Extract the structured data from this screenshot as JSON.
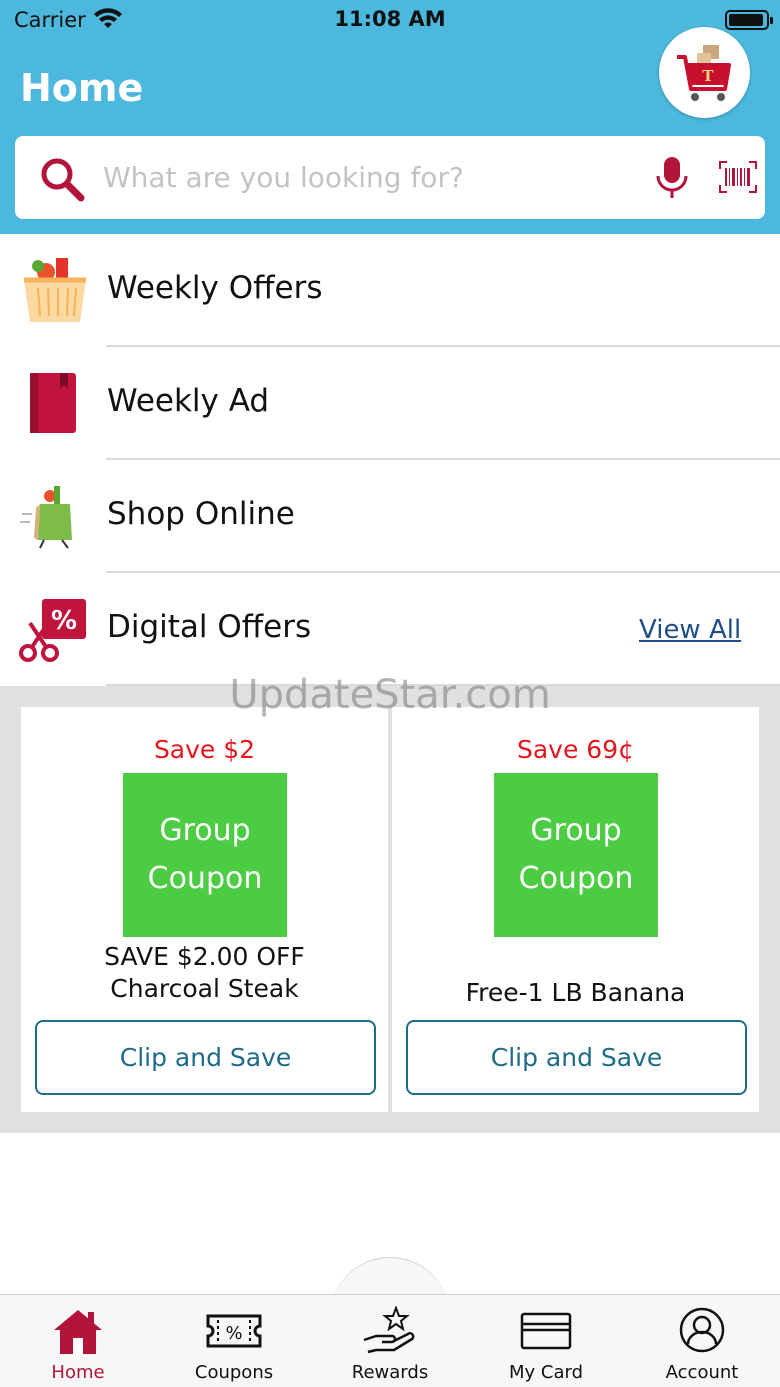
{
  "status_bar": {
    "carrier": "Carrier",
    "time": "11:08 AM"
  },
  "header": {
    "title": "Home"
  },
  "search": {
    "placeholder": "What are you looking for?"
  },
  "menu": {
    "items": [
      {
        "label": "Weekly Offers",
        "icon": "basket-icon"
      },
      {
        "label": "Weekly Ad",
        "icon": "book-icon"
      },
      {
        "label": "Shop Online",
        "icon": "grocery-bag-icon"
      },
      {
        "label": "Digital Offers",
        "icon": "coupon-scissors-icon"
      }
    ],
    "view_all": "View All"
  },
  "watermark": "UpdateStar.com",
  "offers": [
    {
      "save": "Save $2",
      "image_text_1": "Group",
      "image_text_2": "Coupon",
      "desc_1": "SAVE $2.00 OFF",
      "desc_2": "Charcoal Steak",
      "button": "Clip and Save"
    },
    {
      "save": "Save 69¢",
      "image_text_1": "Group",
      "image_text_2": "Coupon",
      "desc_1": "Free-1 LB Banana",
      "button": "Clip and Save"
    }
  ],
  "tabs": [
    {
      "label": "Home",
      "icon": "home-icon",
      "active": true
    },
    {
      "label": "Coupons",
      "icon": "coupon-ticket-icon"
    },
    {
      "label": "Rewards",
      "icon": "rewards-hand-star-icon"
    },
    {
      "label": "My Card",
      "icon": "card-icon"
    },
    {
      "label": "Account",
      "icon": "account-icon"
    }
  ],
  "colors": {
    "header": "#4cb8dd",
    "accent": "#b3143c",
    "coupon_green": "#4ccc43",
    "save_red": "#e5161b",
    "button_teal": "#1e6b88"
  }
}
